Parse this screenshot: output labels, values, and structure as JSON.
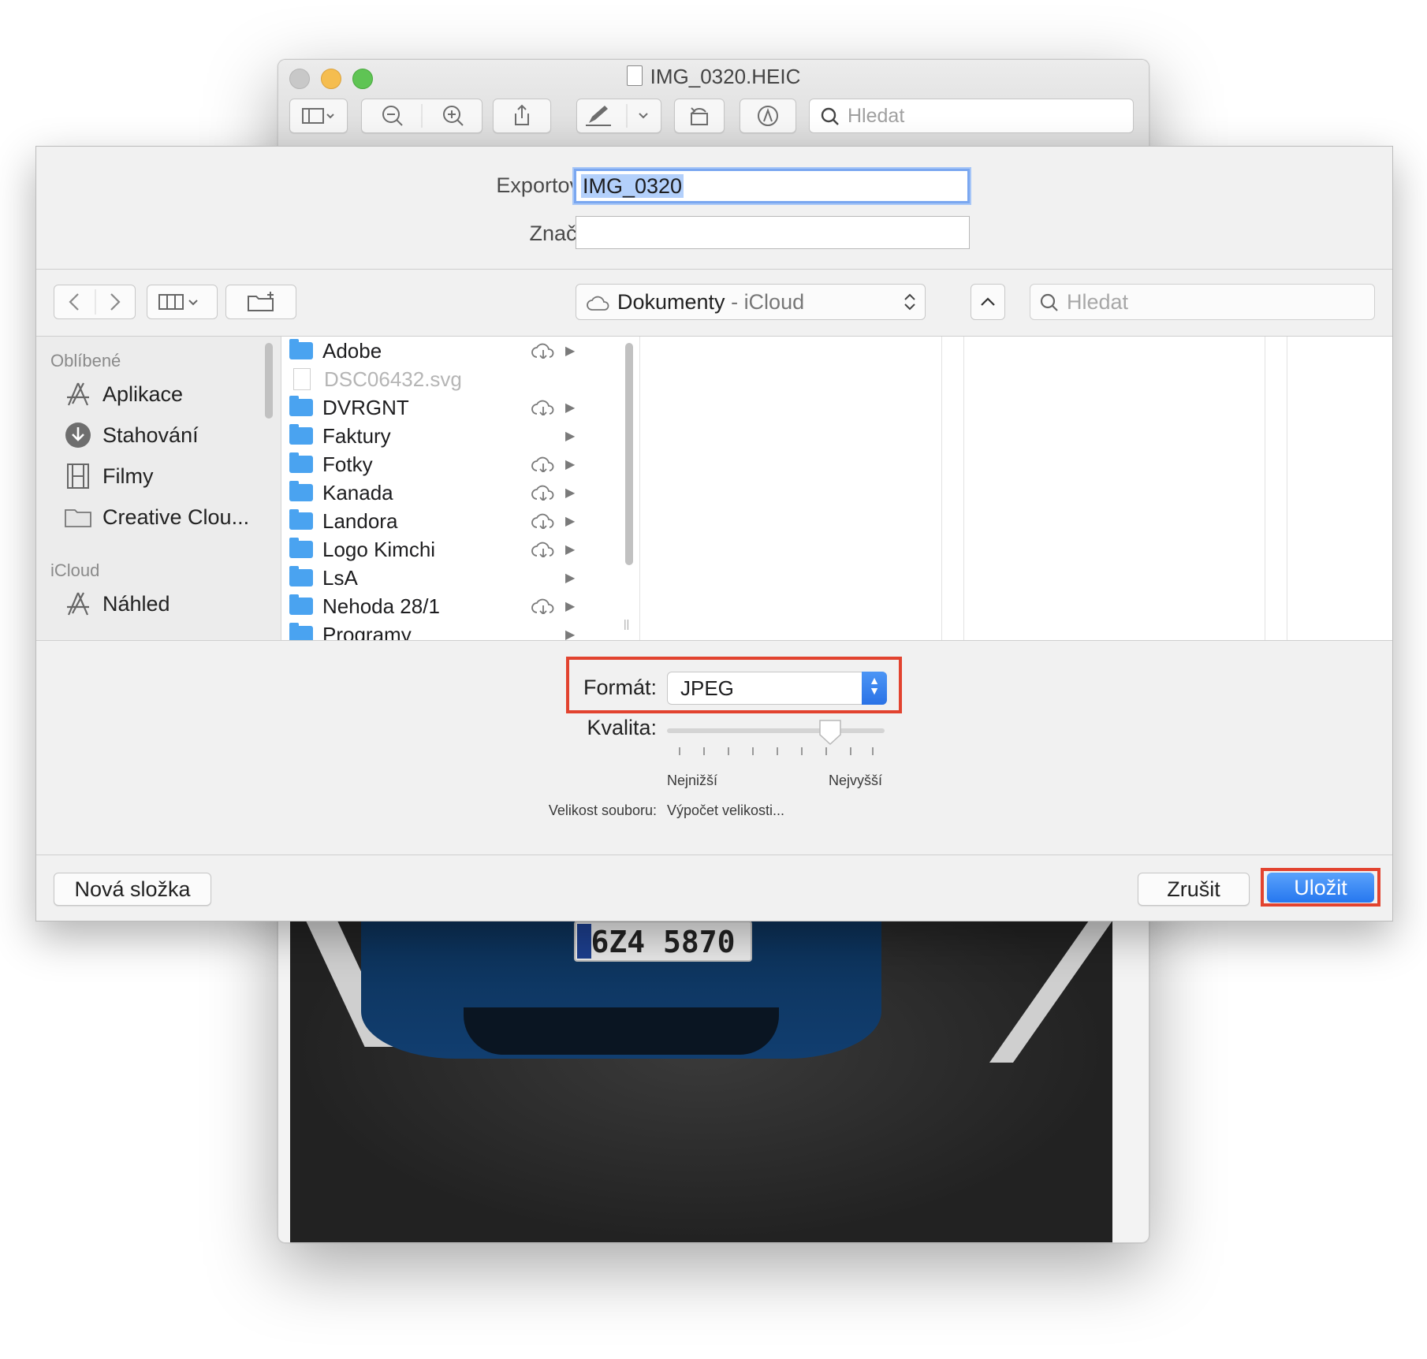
{
  "preview_window": {
    "title": "IMG_0320.HEIC",
    "search_placeholder": "Hledat",
    "photo_plate_text": "6Z4 5870",
    "traffic_lights": {
      "close": "#c8c8c8",
      "minimize": "#f5bd4f",
      "zoom": "#5fc454"
    }
  },
  "sheet": {
    "export_label": "Exportovat:",
    "export_value": "IMG_0320",
    "tags_label": "Značky:",
    "tags_value": "",
    "location_name": "Dokumenty",
    "location_separator": " - ",
    "location_sub": "iCloud",
    "search_placeholder": "Hledat",
    "sidebar": {
      "favorites_header": "Oblíbené",
      "favorites": [
        {
          "label": "Aplikace",
          "icon": "apps-icon"
        },
        {
          "label": "Stahování",
          "icon": "download-icon"
        },
        {
          "label": "Filmy",
          "icon": "film-icon"
        },
        {
          "label": "Creative Clou...",
          "icon": "folder-icon"
        }
      ],
      "icloud_header": "iCloud",
      "icloud": [
        {
          "label": "Náhled",
          "icon": "apps-icon"
        }
      ]
    },
    "files": [
      {
        "name": "Adobe",
        "type": "folder",
        "cloud": true,
        "disabled": false
      },
      {
        "name": "DSC06432.svg",
        "type": "file",
        "cloud": false,
        "disabled": true
      },
      {
        "name": "DVRGNT",
        "type": "folder",
        "cloud": true,
        "disabled": false
      },
      {
        "name": "Faktury",
        "type": "folder",
        "cloud": false,
        "disabled": false
      },
      {
        "name": "Fotky",
        "type": "folder",
        "cloud": true,
        "disabled": false
      },
      {
        "name": "Kanada",
        "type": "folder",
        "cloud": true,
        "disabled": false
      },
      {
        "name": "Landora",
        "type": "folder",
        "cloud": true,
        "disabled": false
      },
      {
        "name": "Logo Kimchi",
        "type": "folder",
        "cloud": true,
        "disabled": false
      },
      {
        "name": "LsA",
        "type": "folder",
        "cloud": false,
        "disabled": false
      },
      {
        "name": "Nehoda 28/1",
        "type": "folder",
        "cloud": true,
        "disabled": false
      },
      {
        "name": "Programy",
        "type": "folder",
        "cloud": false,
        "disabled": false
      }
    ],
    "format_label": "Formát:",
    "format_value": "JPEG",
    "quality_label": "Kvalita:",
    "quality_level": 0.75,
    "quality_min": "Nejnižší",
    "quality_max": "Nejvyšší",
    "filesize_label": "Velikost souboru:",
    "filesize_value": "Výpočet velikosti...",
    "new_folder_button": "Nová složka",
    "cancel_button": "Zrušit",
    "save_button": "Uložit",
    "highlight_color": "#e2432f",
    "accent_color": "#2677ef"
  }
}
